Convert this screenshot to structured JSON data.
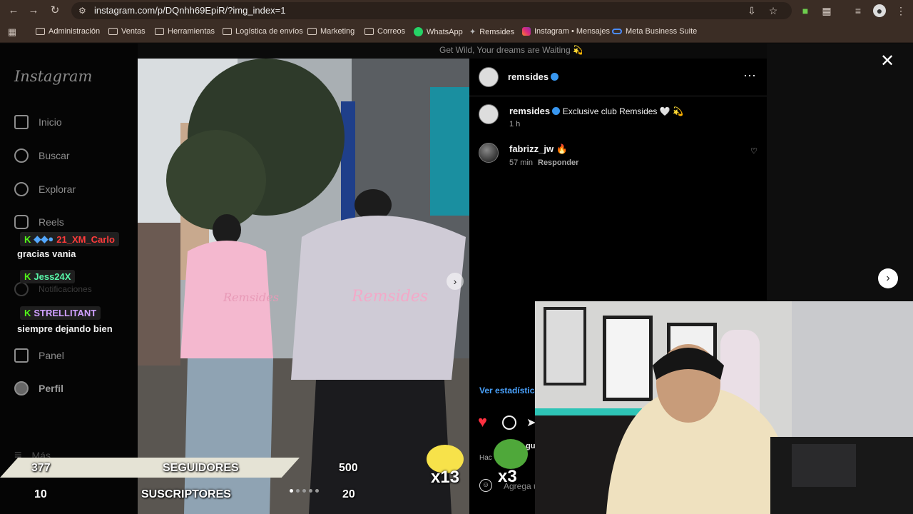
{
  "browser": {
    "url": "instagram.com/p/DQnhh69EpiR/?img_index=1",
    "bookmarks": [
      {
        "label": "Administración",
        "icon": "folder-icon"
      },
      {
        "label": "Ventas",
        "icon": "folder-icon"
      },
      {
        "label": "Herramientas",
        "icon": "folder-icon"
      },
      {
        "label": "Logística de envíos",
        "icon": "folder-icon"
      },
      {
        "label": "Marketing",
        "icon": "folder-icon"
      },
      {
        "label": "Correos",
        "icon": "folder-icon"
      },
      {
        "label": "WhatsApp",
        "icon": "whatsapp-icon"
      },
      {
        "label": "Remsides",
        "icon": "remsides-icon"
      },
      {
        "label": "Instagram • Mensajes",
        "icon": "instagram-icon"
      },
      {
        "label": "Meta Business Suite",
        "icon": "meta-icon"
      }
    ]
  },
  "sidebar": {
    "logo": "Instagram",
    "items": [
      {
        "label": "Inicio",
        "icon": "home-icon"
      },
      {
        "label": "Buscar",
        "icon": "search-icon"
      },
      {
        "label": "Explorar",
        "icon": "compass-icon"
      },
      {
        "label": "Reels",
        "icon": "reels-icon"
      },
      {
        "label": "Notificaciones",
        "icon": "heart-icon"
      },
      {
        "label": "Panel",
        "icon": "dashboard-icon"
      },
      {
        "label": "Perfil",
        "icon": "profile-icon"
      },
      {
        "label": "Más",
        "icon": "menu-icon"
      }
    ]
  },
  "background_caption": {
    "line1": "Get Wild, Your dreams are Waiting 💫",
    "line2": "Exclusive club Remsides"
  },
  "post": {
    "author": "remsides",
    "caption_author": "remsides",
    "caption": "Exclusive club Remsides 🤍 💫",
    "caption_time": "1 h",
    "comments": [
      {
        "user": "fabrizz_jw",
        "text": "🔥",
        "time": "57 min",
        "reply": "Responder"
      }
    ],
    "insights": "Ver estadísticas",
    "add_comment_placeholder": "Agrega un comentario...",
    "liked_by_prefix": "gu",
    "liked_by_sub": "Hac",
    "liked": true
  },
  "stream": {
    "chat": [
      {
        "type": "badge",
        "name": "21_XM_Carlo",
        "color": "#ff3b3b"
      },
      {
        "type": "message",
        "text": "gracias vania"
      },
      {
        "type": "badge",
        "name": "Jess24X",
        "color": "#58f5a8"
      },
      {
        "type": "badge",
        "name": "STRELLITANT",
        "color": "#cfa0ff"
      },
      {
        "type": "message",
        "text": "siempre dejando bien"
      }
    ],
    "stats": {
      "followers_current": "377",
      "followers_label": "SEGUIDORES",
      "followers_goal": "500",
      "subs_current": "10",
      "subs_label": "SUSCRIPTORES",
      "subs_goal": "20"
    },
    "emote1_count": "x13",
    "emote2_count": "x3"
  },
  "colors": {
    "accent": "#3897f0",
    "kick": "#53fc18",
    "like": "#ff3040"
  }
}
